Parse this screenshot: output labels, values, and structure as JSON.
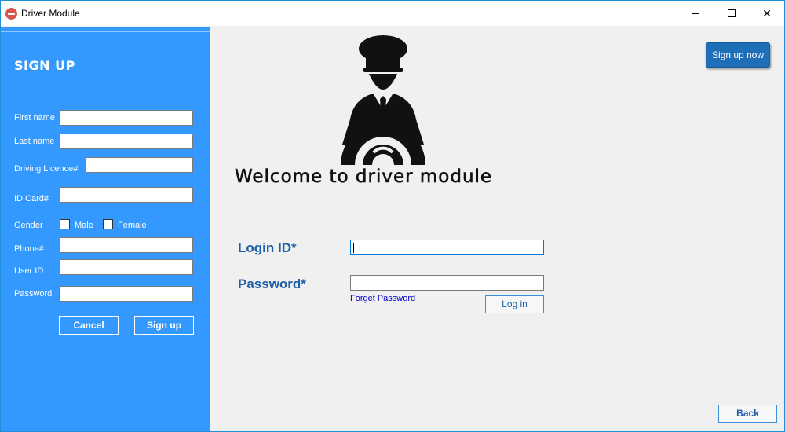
{
  "window": {
    "title": "Driver Module",
    "minimize": "",
    "maximize": "",
    "close": "✕"
  },
  "signup_panel": {
    "title": "SIGN UP",
    "fields": {
      "first_name": "First name",
      "last_name": "Last name",
      "driving_licence": "Driving Licence#",
      "id_card": "ID Card#",
      "gender": "Gender",
      "male": "Male",
      "female": "Female",
      "phone": "Phone#",
      "user_id": "User ID",
      "password": "Password"
    },
    "cancel_label": "Cancel",
    "signup_label": "Sign up"
  },
  "main": {
    "welcome": "Welcome to driver module",
    "signup_now_label": "Sign up now",
    "login_id_label": "Login ID*",
    "password_label": "Password*",
    "forget_password": "Forget Password",
    "login_label": "Log in",
    "back_label": "Back"
  },
  "colors": {
    "panel": "#3399ff",
    "accent": "#1f5fa8",
    "signup_now": "#1e6fb8"
  }
}
